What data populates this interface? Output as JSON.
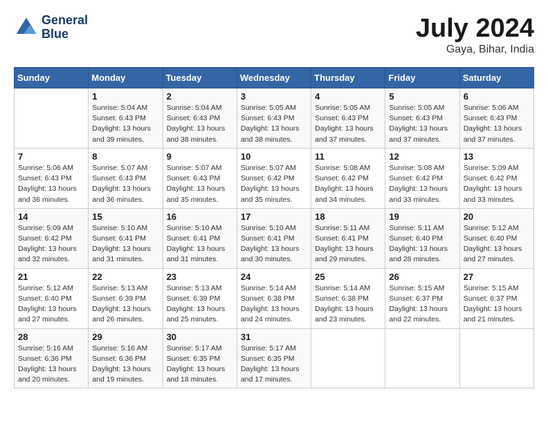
{
  "header": {
    "logo_line1": "General",
    "logo_line2": "Blue",
    "month": "July 2024",
    "location": "Gaya, Bihar, India"
  },
  "days_of_week": [
    "Sunday",
    "Monday",
    "Tuesday",
    "Wednesday",
    "Thursday",
    "Friday",
    "Saturday"
  ],
  "weeks": [
    [
      {
        "day": "",
        "info": ""
      },
      {
        "day": "1",
        "sunrise": "5:04 AM",
        "sunset": "6:43 PM",
        "daylight": "13 hours and 39 minutes."
      },
      {
        "day": "2",
        "sunrise": "5:04 AM",
        "sunset": "6:43 PM",
        "daylight": "13 hours and 38 minutes."
      },
      {
        "day": "3",
        "sunrise": "5:05 AM",
        "sunset": "6:43 PM",
        "daylight": "13 hours and 38 minutes."
      },
      {
        "day": "4",
        "sunrise": "5:05 AM",
        "sunset": "6:43 PM",
        "daylight": "13 hours and 37 minutes."
      },
      {
        "day": "5",
        "sunrise": "5:05 AM",
        "sunset": "6:43 PM",
        "daylight": "13 hours and 37 minutes."
      },
      {
        "day": "6",
        "sunrise": "5:06 AM",
        "sunset": "6:43 PM",
        "daylight": "13 hours and 37 minutes."
      }
    ],
    [
      {
        "day": "7",
        "sunrise": "5:06 AM",
        "sunset": "6:43 PM",
        "daylight": "13 hours and 36 minutes."
      },
      {
        "day": "8",
        "sunrise": "5:07 AM",
        "sunset": "6:43 PM",
        "daylight": "13 hours and 36 minutes."
      },
      {
        "day": "9",
        "sunrise": "5:07 AM",
        "sunset": "6:43 PM",
        "daylight": "13 hours and 35 minutes."
      },
      {
        "day": "10",
        "sunrise": "5:07 AM",
        "sunset": "6:42 PM",
        "daylight": "13 hours and 35 minutes."
      },
      {
        "day": "11",
        "sunrise": "5:08 AM",
        "sunset": "6:42 PM",
        "daylight": "13 hours and 34 minutes."
      },
      {
        "day": "12",
        "sunrise": "5:08 AM",
        "sunset": "6:42 PM",
        "daylight": "13 hours and 33 minutes."
      },
      {
        "day": "13",
        "sunrise": "5:09 AM",
        "sunset": "6:42 PM",
        "daylight": "13 hours and 33 minutes."
      }
    ],
    [
      {
        "day": "14",
        "sunrise": "5:09 AM",
        "sunset": "6:42 PM",
        "daylight": "13 hours and 32 minutes."
      },
      {
        "day": "15",
        "sunrise": "5:10 AM",
        "sunset": "6:41 PM",
        "daylight": "13 hours and 31 minutes."
      },
      {
        "day": "16",
        "sunrise": "5:10 AM",
        "sunset": "6:41 PM",
        "daylight": "13 hours and 31 minutes."
      },
      {
        "day": "17",
        "sunrise": "5:10 AM",
        "sunset": "6:41 PM",
        "daylight": "13 hours and 30 minutes."
      },
      {
        "day": "18",
        "sunrise": "5:11 AM",
        "sunset": "6:41 PM",
        "daylight": "13 hours and 29 minutes."
      },
      {
        "day": "19",
        "sunrise": "5:11 AM",
        "sunset": "6:40 PM",
        "daylight": "13 hours and 28 minutes."
      },
      {
        "day": "20",
        "sunrise": "5:12 AM",
        "sunset": "6:40 PM",
        "daylight": "13 hours and 27 minutes."
      }
    ],
    [
      {
        "day": "21",
        "sunrise": "5:12 AM",
        "sunset": "6:40 PM",
        "daylight": "13 hours and 27 minutes."
      },
      {
        "day": "22",
        "sunrise": "5:13 AM",
        "sunset": "6:39 PM",
        "daylight": "13 hours and 26 minutes."
      },
      {
        "day": "23",
        "sunrise": "5:13 AM",
        "sunset": "6:39 PM",
        "daylight": "13 hours and 25 minutes."
      },
      {
        "day": "24",
        "sunrise": "5:14 AM",
        "sunset": "6:38 PM",
        "daylight": "13 hours and 24 minutes."
      },
      {
        "day": "25",
        "sunrise": "5:14 AM",
        "sunset": "6:38 PM",
        "daylight": "13 hours and 23 minutes."
      },
      {
        "day": "26",
        "sunrise": "5:15 AM",
        "sunset": "6:37 PM",
        "daylight": "13 hours and 22 minutes."
      },
      {
        "day": "27",
        "sunrise": "5:15 AM",
        "sunset": "6:37 PM",
        "daylight": "13 hours and 21 minutes."
      }
    ],
    [
      {
        "day": "28",
        "sunrise": "5:16 AM",
        "sunset": "6:36 PM",
        "daylight": "13 hours and 20 minutes."
      },
      {
        "day": "29",
        "sunrise": "5:16 AM",
        "sunset": "6:36 PM",
        "daylight": "13 hours and 19 minutes."
      },
      {
        "day": "30",
        "sunrise": "5:17 AM",
        "sunset": "6:35 PM",
        "daylight": "13 hours and 18 minutes."
      },
      {
        "day": "31",
        "sunrise": "5:17 AM",
        "sunset": "6:35 PM",
        "daylight": "13 hours and 17 minutes."
      },
      {
        "day": "",
        "info": ""
      },
      {
        "day": "",
        "info": ""
      },
      {
        "day": "",
        "info": ""
      }
    ]
  ]
}
